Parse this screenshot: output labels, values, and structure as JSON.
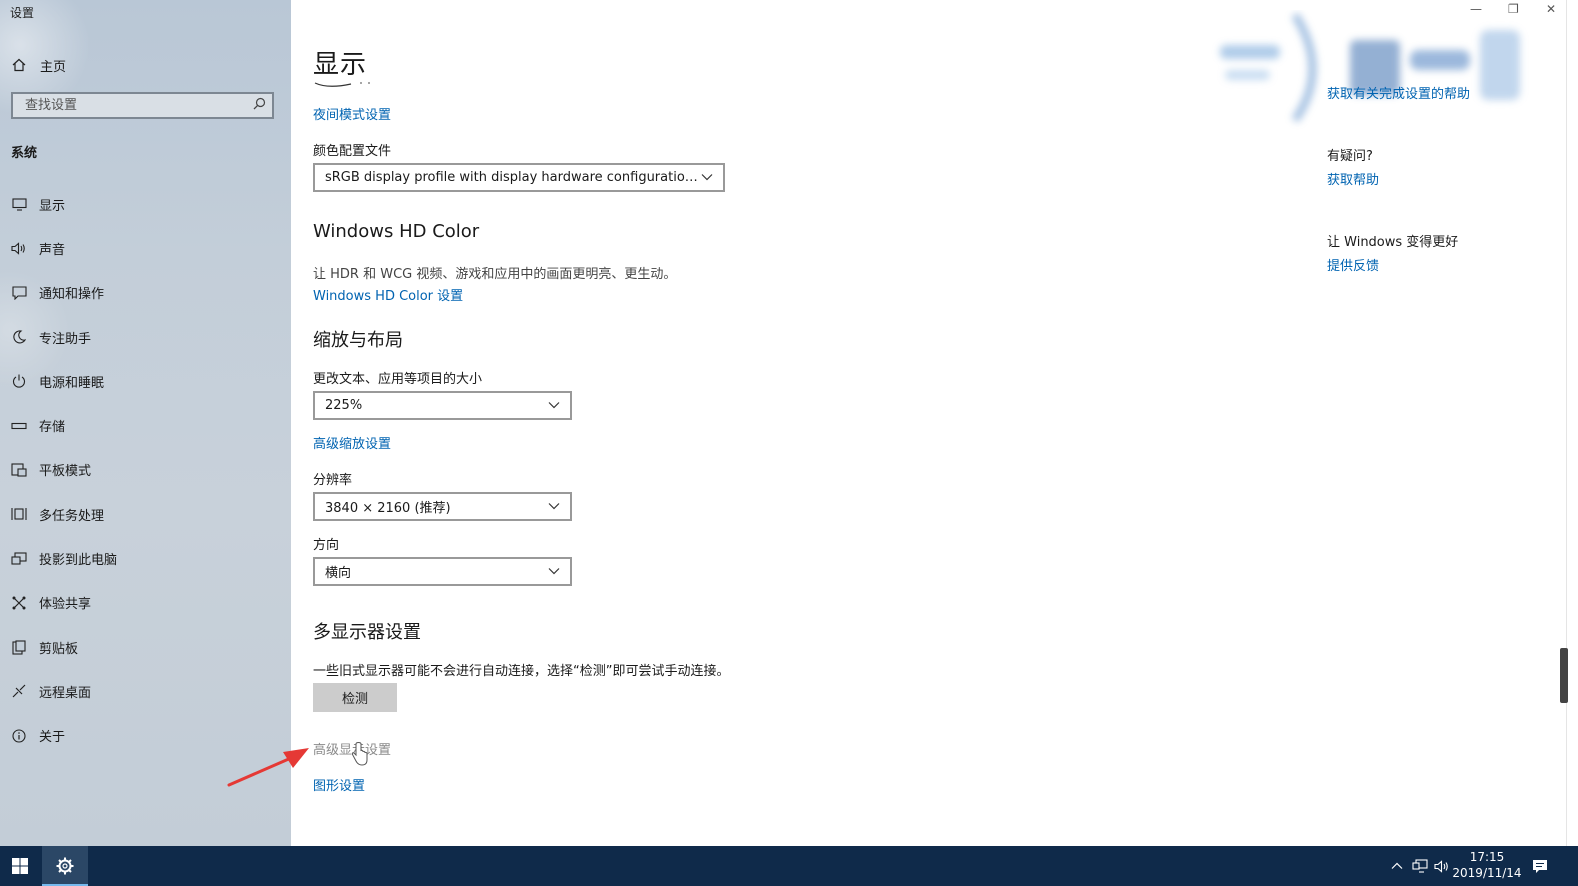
{
  "window": {
    "title": "设置",
    "controls": {
      "minimize": "—",
      "maximize": "❐",
      "close": "✕"
    }
  },
  "sidebar": {
    "home_label": "主页",
    "search_placeholder": "查找设置",
    "section_label": "系统",
    "items": [
      {
        "label": "显示",
        "icon": "monitor-icon"
      },
      {
        "label": "声音",
        "icon": "speaker-icon"
      },
      {
        "label": "通知和操作",
        "icon": "notification-icon"
      },
      {
        "label": "专注助手",
        "icon": "moon-icon"
      },
      {
        "label": "电源和睡眠",
        "icon": "power-icon"
      },
      {
        "label": "存储",
        "icon": "storage-icon"
      },
      {
        "label": "平板模式",
        "icon": "tablet-icon"
      },
      {
        "label": "多任务处理",
        "icon": "multitask-icon"
      },
      {
        "label": "投影到此电脑",
        "icon": "project-icon"
      },
      {
        "label": "体验共享",
        "icon": "share-icon"
      },
      {
        "label": "剪贴板",
        "icon": "clipboard-icon"
      },
      {
        "label": "远程桌面",
        "icon": "remote-icon"
      },
      {
        "label": "关于",
        "icon": "info-icon"
      }
    ]
  },
  "main": {
    "title": "显示",
    "night_light_link": "夜间模式设置",
    "color_profile_label": "颜色配置文件",
    "color_profile_value": "sRGB display profile with display hardware configuration data d...",
    "hdr_title": "Windows HD Color",
    "hdr_desc": "让 HDR 和 WCG 视频、游戏和应用中的画面更明亮、更生动。",
    "hdr_link": "Windows HD Color 设置",
    "scale_title": "缩放与布局",
    "scale_label": "更改文本、应用等项目的大小",
    "scale_value": "225%",
    "advanced_scale_link": "高级缩放设置",
    "resolution_label": "分辨率",
    "resolution_value": "3840 × 2160 (推荐)",
    "orientation_label": "方向",
    "orientation_value": "横向",
    "multi_title": "多显示器设置",
    "multi_desc": "一些旧式显示器可能不会进行自动连接，选择“检测”即可尝试手动连接。",
    "detect_button": "检测",
    "advanced_display_link": "高级显示设置",
    "graphics_link": "图形设置"
  },
  "right": {
    "help_link": "获取有关完成设置的帮助",
    "question_title": "有疑问?",
    "get_help_link": "获取帮助",
    "improve_title": "让 Windows 变得更好",
    "feedback_link": "提供反馈"
  },
  "taskbar": {
    "time": "17:15",
    "date": "2019/11/14"
  },
  "colors": {
    "accent": "#0063b1",
    "taskbar": "#0f2a4a",
    "annotation_arrow": "#e53935"
  }
}
